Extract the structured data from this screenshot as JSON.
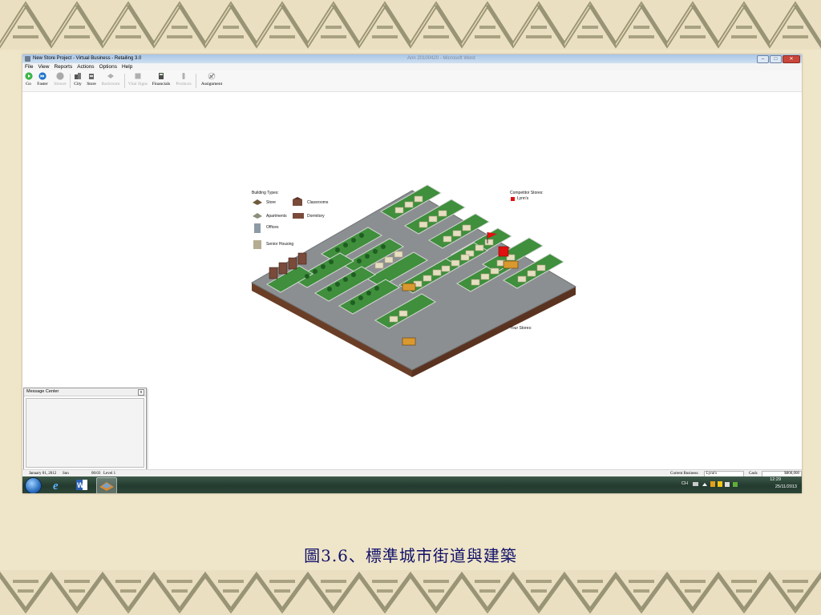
{
  "window": {
    "title": "New Store Project - Virtual Business - Retailing 3.0",
    "ghost_title": "Ann 20100420 - Microsoft Word",
    "controls": {
      "minimize": "–",
      "maximize": "□",
      "close": "✕"
    }
  },
  "menu": [
    "File",
    "View",
    "Reports",
    "Actions",
    "Options",
    "Help"
  ],
  "toolbar": [
    {
      "label": "Go",
      "icon": "go-icon",
      "enabled": true
    },
    {
      "label": "Faster",
      "icon": "faster-icon",
      "enabled": true
    },
    {
      "label": "Slower",
      "icon": "slower-icon",
      "enabled": false
    },
    {
      "label": "City",
      "icon": "city-icon",
      "enabled": true
    },
    {
      "label": "Store",
      "icon": "store-icon",
      "enabled": true
    },
    {
      "label": "Backroom",
      "icon": "backroom-icon",
      "enabled": false
    },
    {
      "label": "Vital Signs",
      "icon": "vital-signs-icon",
      "enabled": false
    },
    {
      "label": "Financials",
      "icon": "financials-icon",
      "enabled": true
    },
    {
      "label": "Products",
      "icon": "products-icon",
      "enabled": false
    },
    {
      "label": "Assignment",
      "icon": "assignment-icon",
      "enabled": true
    }
  ],
  "legend": {
    "title": "Building Types:",
    "items": [
      "Store",
      "Classrooms",
      "Apartments",
      "Dormitory",
      "Offices",
      "Senior Housing"
    ]
  },
  "competitors": {
    "title": "Competitor Stores:",
    "items": [
      {
        "name": "Lynn's",
        "color": "#e01010"
      }
    ]
  },
  "your_stores": {
    "title": "Your Stores:"
  },
  "message_center": {
    "title": "Message Center",
    "close": "x"
  },
  "status": {
    "date": "January 01, 2012",
    "day": "Sun",
    "time": "00:03",
    "level": "Level 1",
    "current_business_label": "Current Business:",
    "current_business": "Lynn's",
    "cash_label": "Cash:",
    "cash": "$800,000"
  },
  "taskbar": {
    "apps": [
      "ie-icon",
      "word-icon",
      "virtual-business-icon"
    ],
    "lang": "CH",
    "time": "12:29",
    "date": "25/11/2013"
  },
  "caption": "圖3.6、標準城市街道與建築",
  "colors": {
    "grass": "#3f8f3c",
    "street": "#8c8f91",
    "building": "#e6dec0",
    "competitor": "#e01010",
    "caption": "#10106a"
  }
}
